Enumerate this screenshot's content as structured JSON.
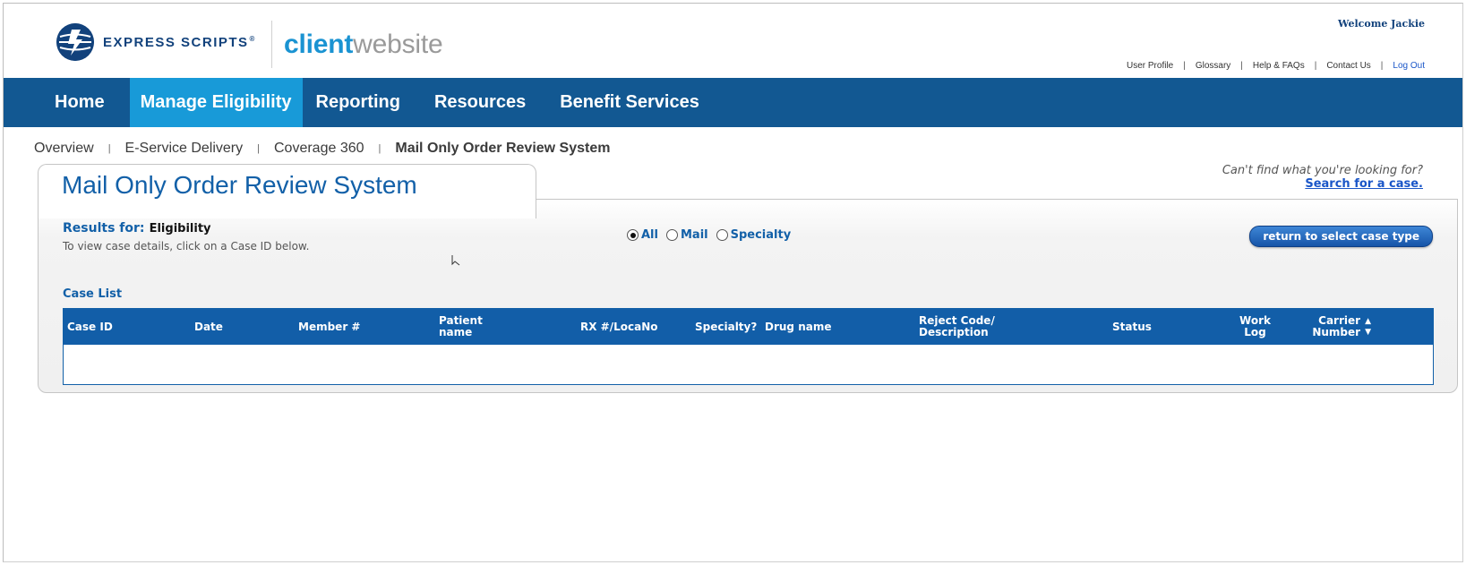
{
  "header": {
    "brand": "EXPRESS SCRIPTS",
    "registered": "®",
    "site_name_bold": "client",
    "site_name_light": "website",
    "welcome": "Welcome Jackie",
    "links": [
      "User Profile",
      "Glossary",
      "Help & FAQs",
      "Contact Us"
    ],
    "separator": "|",
    "logout": "Log Out"
  },
  "nav": {
    "items": [
      "Home",
      "Manage Eligibility",
      "Reporting",
      "Resources",
      "Benefit Services"
    ],
    "active": "Manage Eligibility"
  },
  "breadcrumbs": {
    "items": [
      "Overview",
      "E-Service Delivery",
      "Coverage 360"
    ],
    "current": "Mail Only Order Review System",
    "separator": "|"
  },
  "panel": {
    "title": "Mail Only Order Review System",
    "help_question": "Can't find what you're looking for?",
    "help_link": "Search for a case.",
    "results_label": "Results for:",
    "results_value": "Eligibility",
    "hint": "To view case details, click on a Case ID below.",
    "filters": [
      {
        "label": "All",
        "selected": true
      },
      {
        "label": "Mail",
        "selected": false
      },
      {
        "label": "Specialty",
        "selected": false
      }
    ],
    "return_button": "return to select case type",
    "case_list_label": "Case List"
  },
  "table": {
    "columns": [
      {
        "l1": "Case ID",
        "l2": ""
      },
      {
        "l1": "Date",
        "l2": ""
      },
      {
        "l1": "Member #",
        "l2": ""
      },
      {
        "l1": "Patient",
        "l2": "name"
      },
      {
        "l1": "RX #/LocaNo",
        "l2": ""
      },
      {
        "l1": "Specialty?",
        "l2": ""
      },
      {
        "l1": "Drug name",
        "l2": ""
      },
      {
        "l1": "Reject Code/",
        "l2": "Description"
      },
      {
        "l1": "Status",
        "l2": ""
      },
      {
        "l1": "Work",
        "l2": "Log"
      },
      {
        "l1": "Carrier",
        "l2": "Number"
      }
    ],
    "rows": []
  },
  "colors": {
    "nav_bg": "#125892",
    "nav_active": "#189ad8",
    "brand_blue": "#12427c",
    "accent": "#1a93d2",
    "table_header": "#125ea8"
  }
}
